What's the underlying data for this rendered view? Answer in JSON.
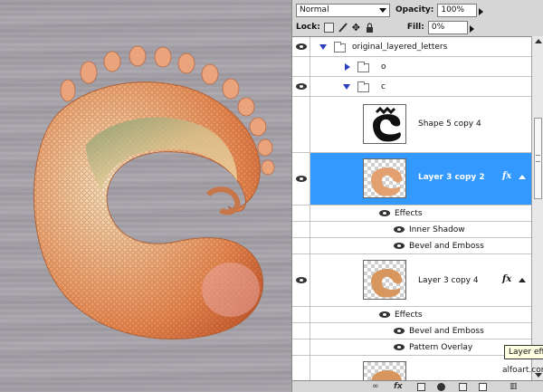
{
  "panel": {
    "blend_mode": "Normal",
    "opacity_label": "Opacity:",
    "opacity_value": "100%",
    "lock_label": "Lock:",
    "fill_label": "Fill:",
    "fill_value": "0%"
  },
  "layers": [
    {
      "kind": "group",
      "name": "original_layered_letters",
      "visible": true,
      "expanded": true
    },
    {
      "kind": "group",
      "name": "o",
      "visible": false,
      "expanded": false
    },
    {
      "kind": "group",
      "name": "c",
      "visible": true,
      "expanded": true
    },
    {
      "kind": "layer",
      "name": "Shape 5 copy 4",
      "visible": false,
      "selected": false
    },
    {
      "kind": "layer",
      "name": "Layer 3 copy 2",
      "visible": true,
      "selected": true,
      "fx": "fx"
    },
    {
      "kind": "effects",
      "label": "Effects"
    },
    {
      "kind": "effect",
      "label": "Inner Shadow"
    },
    {
      "kind": "effect",
      "label": "Bevel and Emboss"
    },
    {
      "kind": "layer",
      "name": "Layer 3 copy 4",
      "visible": true,
      "selected": false,
      "fx": "fx"
    },
    {
      "kind": "effects",
      "label": "Effects"
    },
    {
      "kind": "effect",
      "label": "Bevel and Emboss"
    },
    {
      "kind": "effect",
      "label": "Pattern Overlay"
    }
  ],
  "tooltip": "Layer effects",
  "watermark": "alfoart.com",
  "bottom_icons": [
    "link-icon",
    "fx-icon",
    "mask-icon",
    "adjustment-icon",
    "group-folder-icon",
    "new-layer-icon",
    "trash-icon"
  ],
  "bottom_fx": "fx",
  "colors": {
    "selection": "#3399ff",
    "panel_bg": "#d6d6d6",
    "canvas_bg": "#a39fa6"
  }
}
